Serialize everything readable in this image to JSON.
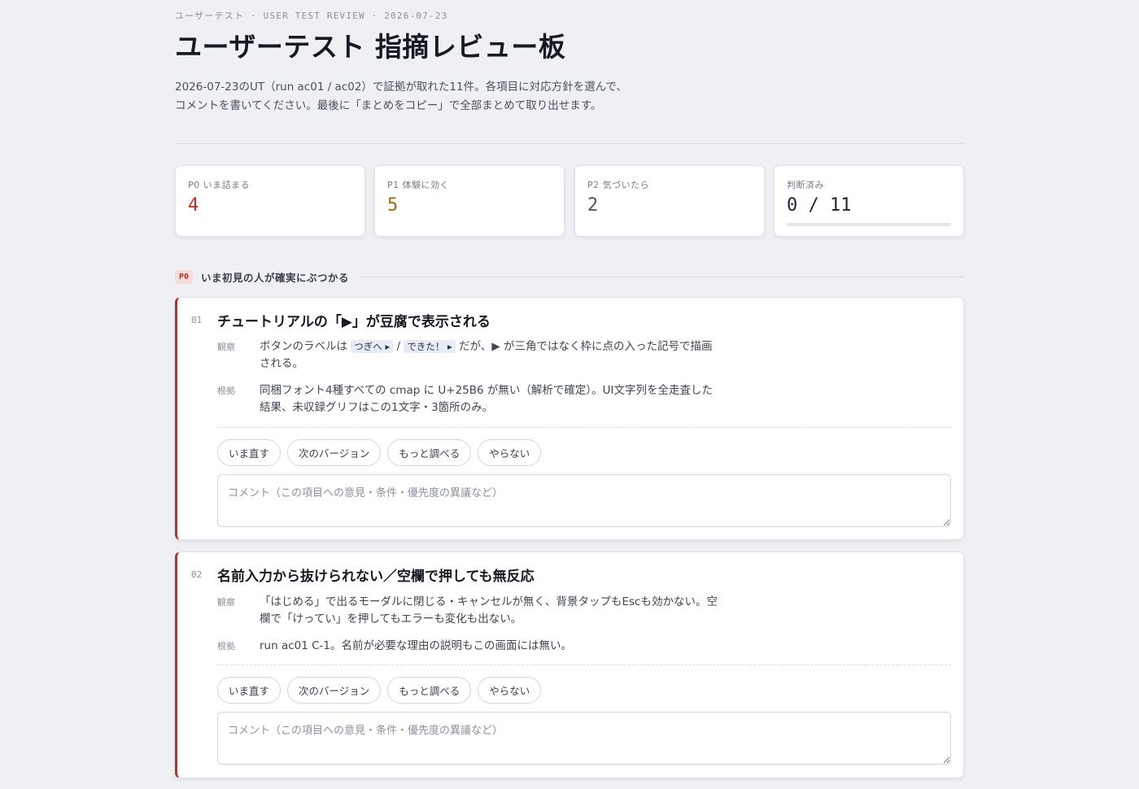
{
  "header": {
    "eyebrow": "ユーザーテスト · USER TEST REVIEW · 2026-07-23",
    "title": "ユーザーテスト 指摘レビュー板",
    "intro": "2026-07-23のUT（run ac01 / ac02）で証拠が取れた11件。各項目に対応方針を選んで、コメントを書いてください。最後に「まとめをコピー」で全部まとめて取り出せます。"
  },
  "stats": [
    {
      "label": "P0 いま詰まる",
      "value": "4",
      "color": "#b3322a"
    },
    {
      "label": "P1 体験に効く",
      "value": "5",
      "color": "#9a6a16"
    },
    {
      "label": "P2 気づいたら",
      "value": "2",
      "color": "#4c5a52"
    },
    {
      "label": "判断済み",
      "value": "0 / 11",
      "color": "#1f2430",
      "progress": 0
    }
  ],
  "section": {
    "badge": "P0",
    "title": "いま初見の人が確実にぶつかる"
  },
  "choices": [
    "いま直す",
    "次のバージョン",
    "もっと調べる",
    "やらない"
  ],
  "comment_placeholder": "コメント（この項目への意見・条件・優先度の異議など）",
  "labels": {
    "observation": "観察",
    "evidence": "根拠"
  },
  "items": [
    {
      "num": "01",
      "title": "チュートリアルの「▶」が豆腐で表示される",
      "obs_pre": "ボタンのラベルは",
      "obs_kbd1": "つぎへ ▸",
      "obs_sep": "/",
      "obs_kbd2": "できた！ ▸",
      "obs_post": "だが、▶ が三角ではなく枠に点の入った記号で描画される。",
      "evidence": "同梱フォント4種すべての cmap に U+25B6 が無い（解析で確定）。UI文字列を全走査した結果、未収録グリフはこの1文字・3箇所のみ。"
    },
    {
      "num": "02",
      "title": "名前入力から抜けられない／空欄で押しても無反応",
      "observation": "「はじめる」で出るモーダルに閉じる・キャンセルが無く、背景タップもEscも効かない。空欄で「けってい」を押してもエラーも変化も出ない。",
      "evidence": "run ac01 C-1。名前が必要な理由の説明もこの画面には無い。"
    }
  ]
}
